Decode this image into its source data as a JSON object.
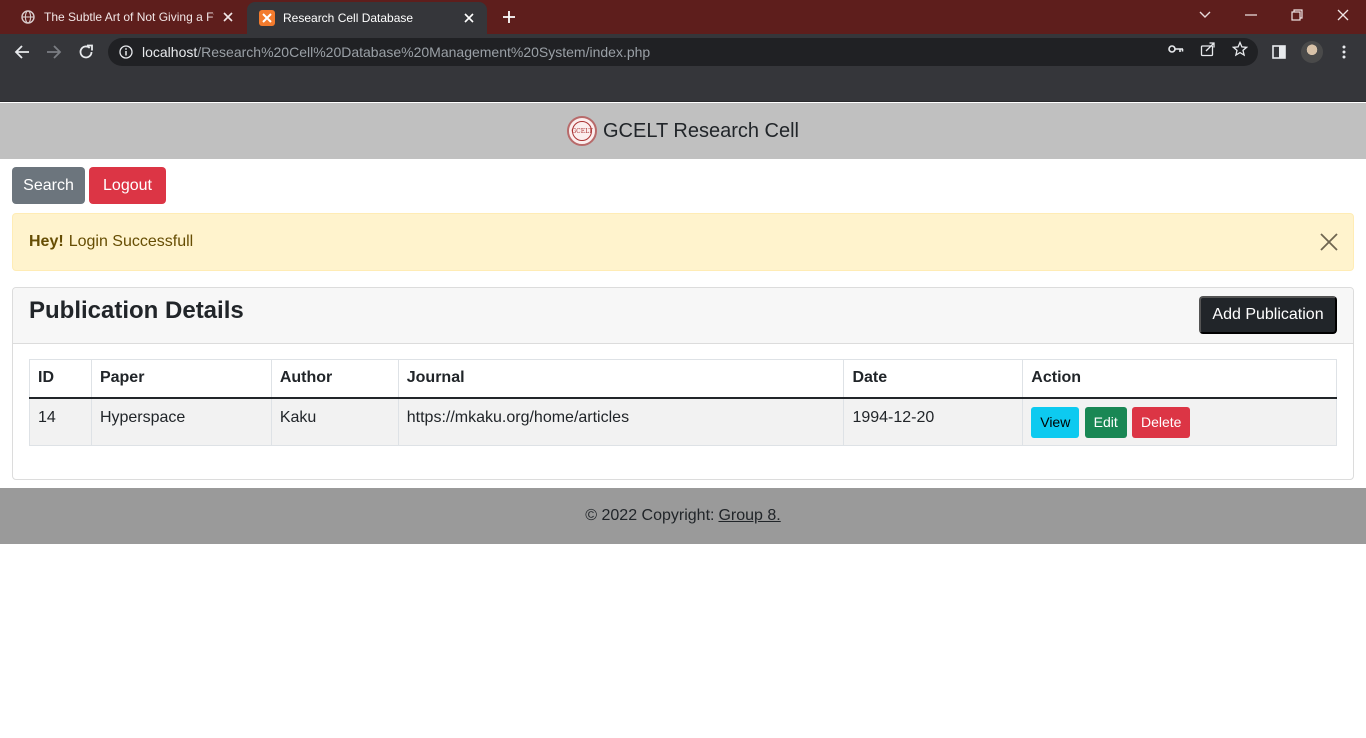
{
  "browser": {
    "tabs": [
      {
        "title": "The Subtle Art of Not Giving a F*",
        "icon": "globe-icon",
        "active": false
      },
      {
        "title": "Research Cell Database",
        "icon": "xampp-icon",
        "active": true
      }
    ],
    "url_host": "localhost",
    "url_path": "/Research%20Cell%20Database%20Management%20System/index.php"
  },
  "brand": {
    "logo_text": "GCELT",
    "title": "GCELT Research Cell"
  },
  "actions": {
    "search_label": "Search",
    "logout_label": "Logout"
  },
  "alert": {
    "strong": "Hey!",
    "message": "Login Successfull"
  },
  "card": {
    "title": "Publication Details",
    "add_label": "Add Publication"
  },
  "table": {
    "headers": [
      "ID",
      "Paper",
      "Author",
      "Journal",
      "Date",
      "Action"
    ],
    "rows": [
      {
        "id": "14",
        "paper": "Hyperspace",
        "author": "Kaku",
        "journal": "https://mkaku.org/home/articles",
        "date": "1994-12-20",
        "view_label": "View",
        "edit_label": "Edit",
        "delete_label": "Delete"
      }
    ]
  },
  "footer": {
    "text": "© 2022 Copyright:",
    "link": "Group 8."
  },
  "colors": {
    "tabstrip": "#5e1e1c",
    "toolbar": "#35363a",
    "brand_bar": "#c0c0c0",
    "search_btn": "#6c757d",
    "danger": "#dc3545",
    "info": "#0dcaf0",
    "success": "#198754",
    "alert_bg": "#fff3cd",
    "footer_bg": "#9a9a9a"
  }
}
